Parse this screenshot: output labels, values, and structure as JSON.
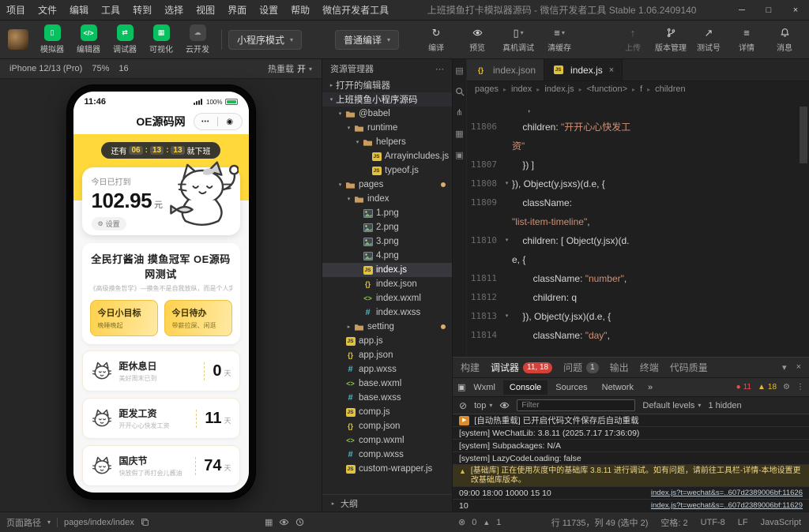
{
  "colors": {
    "green": "#07c160",
    "app-yellow": "#ffd83a",
    "badge-red": "#d1423b",
    "warn-yellow": "#e2b93d",
    "string-orange": "#ce9178",
    "editor-bg": "#1f1f1f"
  },
  "titlebar": {
    "menus": [
      "项目",
      "文件",
      "编辑",
      "工具",
      "转到",
      "选择",
      "视图",
      "界面",
      "设置",
      "帮助",
      "微信开发者工具"
    ],
    "title": "上班摸鱼打卡模拟器源码 - 微信开发者工具 Stable 1.06.2409140"
  },
  "toolbar": {
    "sim_buttons": [
      {
        "label": "模拟器",
        "icon": "phone",
        "active": true
      },
      {
        "label": "编辑器",
        "icon": "code",
        "active": true
      },
      {
        "label": "调试器",
        "icon": "swap",
        "active": true
      },
      {
        "label": "可视化",
        "icon": "grid",
        "active": true
      },
      {
        "label": "云开发",
        "icon": "cloud",
        "active": false
      }
    ],
    "mode_select": "小程序模式",
    "compile_select": "普通编译",
    "compile_actions": [
      {
        "label": "编译",
        "icon": "refresh"
      },
      {
        "label": "预览",
        "icon": "eye"
      },
      {
        "label": "真机调试",
        "icon": "device",
        "caret": true
      },
      {
        "label": "清缓存",
        "icon": "layers",
        "caret": true
      }
    ],
    "right_actions": [
      {
        "label": "上传",
        "icon": "upload",
        "disabled": true
      },
      {
        "label": "版本管理",
        "icon": "branch"
      },
      {
        "label": "测试号",
        "icon": "share"
      },
      {
        "label": "详情",
        "icon": "list"
      },
      {
        "label": "消息",
        "icon": "bell"
      }
    ]
  },
  "simulator": {
    "device": "iPhone 12/13 (Pro)",
    "zoom": "75%",
    "network": "16",
    "hot_reload_label": "热重载",
    "hot_reload_state": "开"
  },
  "phone": {
    "time": "11:46",
    "battery": "100%",
    "nav_title": "OE源码网",
    "countdown": {
      "prefix": "还有",
      "parts": [
        "06",
        "13",
        "13"
      ],
      "separator": ":",
      "suffix": "就下班"
    },
    "earn": {
      "label": "今日已打到",
      "amount": "102.95",
      "unit": "元",
      "settings": "设置"
    },
    "slogan": {
      "title": "全民打酱油 摸鱼冠军 OE源码网测试",
      "subtitle": "《高级摸鱼哲学》—摸鱼不是自我放纵，而是个人实力的积蓄！"
    },
    "goals": [
      {
        "title": "今日小目标",
        "desc": "晚睡晚起"
      },
      {
        "title": "今日待办",
        "desc": "带薪拉屎、闲逛"
      }
    ],
    "countdowns": [
      {
        "title": "距休息日",
        "desc": "美好周末已到",
        "days": "0"
      },
      {
        "title": "距发工资",
        "desc": "开开心心快发工资",
        "days": "11"
      },
      {
        "title": "国庆节",
        "desc": "快放假了再打会儿酱油",
        "days": "74"
      }
    ],
    "day_unit": "天"
  },
  "explorer": {
    "header": "资源管理器",
    "outline": "大纲",
    "tree": [
      {
        "label": "打开的编辑器",
        "kind": "section",
        "chevron": "right",
        "indent": 0
      },
      {
        "label": "上班摸鱼小程序源码",
        "kind": "root",
        "chevron": "down",
        "indent": 0
      },
      {
        "label": "@babel",
        "kind": "folder",
        "chevron": "down",
        "indent": 1
      },
      {
        "label": "runtime",
        "kind": "folder",
        "chevron": "down",
        "indent": 2
      },
      {
        "label": "helpers",
        "kind": "folder",
        "chevron": "down",
        "indent": 3
      },
      {
        "label": "Arrayincludes.js",
        "kind": "js",
        "indent": 4
      },
      {
        "label": "typeof.js",
        "kind": "js",
        "indent": 4
      },
      {
        "label": "pages",
        "kind": "folder",
        "chevron": "down",
        "indent": 1,
        "dot": true
      },
      {
        "label": "index",
        "kind": "folder",
        "chevron": "down",
        "indent": 2
      },
      {
        "label": "1.png",
        "kind": "png",
        "indent": 3
      },
      {
        "label": "2.png",
        "kind": "png",
        "indent": 3
      },
      {
        "label": "3.png",
        "kind": "png",
        "indent": 3
      },
      {
        "label": "4.png",
        "kind": "png",
        "indent": 3
      },
      {
        "label": "index.js",
        "kind": "js",
        "indent": 3,
        "selected": true
      },
      {
        "label": "index.json",
        "kind": "json",
        "indent": 3
      },
      {
        "label": "index.wxml",
        "kind": "wxml",
        "indent": 3
      },
      {
        "label": "index.wxss",
        "kind": "wxss",
        "indent": 3
      },
      {
        "label": "setting",
        "kind": "folder",
        "chevron": "right",
        "indent": 2,
        "dot": true
      },
      {
        "label": "app.js",
        "kind": "js",
        "indent": 1
      },
      {
        "label": "app.json",
        "kind": "json",
        "indent": 1
      },
      {
        "label": "app.wxss",
        "kind": "wxss",
        "indent": 1
      },
      {
        "label": "base.wxml",
        "kind": "wxml",
        "indent": 1
      },
      {
        "label": "base.wxss",
        "kind": "wxss",
        "indent": 1
      },
      {
        "label": "comp.js",
        "kind": "js",
        "indent": 1
      },
      {
        "label": "comp.json",
        "kind": "json",
        "indent": 1
      },
      {
        "label": "comp.wxml",
        "kind": "wxml",
        "indent": 1
      },
      {
        "label": "comp.wxss",
        "kind": "wxss",
        "indent": 1
      },
      {
        "label": "custom-wrapper.js",
        "kind": "js",
        "indent": 1
      }
    ]
  },
  "editor": {
    "tabs": [
      {
        "label": "index.json",
        "icon": "json",
        "active": false
      },
      {
        "label": "index.js",
        "icon": "js",
        "active": true,
        "close": true
      }
    ],
    "breadcrumb": [
      "pages",
      "index",
      "index.js",
      "<function>",
      "f",
      "children"
    ],
    "code": [
      {
        "n": "",
        "segs": [
          [
            "p",
            "      ,"
          ]
        ]
      },
      {
        "n": "11806",
        "segs": [
          [
            "p",
            "    children: "
          ],
          [
            "s",
            "\"开开心心快发工"
          ]
        ]
      },
      {
        "n": "",
        "segs": [
          [
            "s",
            "资\""
          ]
        ]
      },
      {
        "n": "11807",
        "segs": [
          [
            "p",
            "    }) ]"
          ]
        ]
      },
      {
        "n": "11808",
        "fold": true,
        "segs": [
          [
            "p",
            "}), Object(y.jsxs)(d.e, {"
          ]
        ]
      },
      {
        "n": "11809",
        "segs": [
          [
            "p",
            "    className: "
          ]
        ]
      },
      {
        "n": "",
        "segs": [
          [
            "s",
            "\"list-item-timeline\""
          ],
          [
            "p",
            ","
          ]
        ]
      },
      {
        "n": "11810",
        "fold": true,
        "segs": [
          [
            "p",
            "    children: [ Object(y.jsx)(d."
          ]
        ]
      },
      {
        "n": "",
        "segs": [
          [
            "p",
            "e, {"
          ]
        ]
      },
      {
        "n": "11811",
        "segs": [
          [
            "p",
            "        className: "
          ],
          [
            "s",
            "\"number\""
          ],
          [
            "p",
            ","
          ]
        ]
      },
      {
        "n": "11812",
        "segs": [
          [
            "p",
            "        children: q"
          ]
        ]
      },
      {
        "n": "11813",
        "fold": true,
        "segs": [
          [
            "p",
            "    }), Object(y.jsx)(d.e, {"
          ]
        ]
      },
      {
        "n": "11814",
        "segs": [
          [
            "p",
            "        className: "
          ],
          [
            "s",
            "\"day\""
          ],
          [
            "p",
            ","
          ]
        ]
      }
    ]
  },
  "debugger": {
    "panel_tabs": [
      {
        "label": "构建"
      },
      {
        "label": "调试器",
        "active": true,
        "badge": "11, 18",
        "badge_style": "red"
      },
      {
        "label": "问题",
        "badge": "1",
        "badge_style": "gray"
      },
      {
        "label": "输出"
      },
      {
        "label": "终端"
      },
      {
        "label": "代码质量"
      }
    ],
    "devtools_tabs": [
      "Wxml",
      "Console",
      "Sources",
      "Network"
    ],
    "active_devtools_tab": "Console",
    "more_tabs": "»",
    "error_count": "11",
    "warning_count": "18",
    "console": {
      "context": "top",
      "filter_placeholder": "Filter",
      "levels": "Default levels",
      "hidden": "1 hidden",
      "messages": [
        {
          "type": "reload",
          "text": "[自动热重载] 已开启代码文件保存后自动重载"
        },
        {
          "type": "log",
          "text": "[system] WeChatLib: 3.8.11 (2025.7.17 17:36:09)"
        },
        {
          "type": "log",
          "text": "[system] Subpackages: N/A"
        },
        {
          "type": "log",
          "text": "[system] LazyCodeLoading: false"
        },
        {
          "type": "warn",
          "text": "[基础库] 正在使用灰度中的基础库 3.8.11 进行调试。如有问题，请前往工具栏-详情-本地设置更改基础库版本。"
        },
        {
          "type": "log",
          "text": "09:00 18:00 10000 15 10",
          "link": "index.js?t=wechat&s=..607d2389006bf:11626"
        },
        {
          "type": "log",
          "text": "10",
          "link": "index.js?t=wechat&s=..607d2389006bf:11629"
        }
      ]
    }
  },
  "statusbar": {
    "path_label": "页面路径",
    "path": "pages/index/index",
    "errors": "0",
    "warnings": "1",
    "items": [
      "行 11735，列 49 (选中 2)",
      "空格: 2",
      "UTF-8",
      "LF",
      "JavaScript"
    ]
  }
}
